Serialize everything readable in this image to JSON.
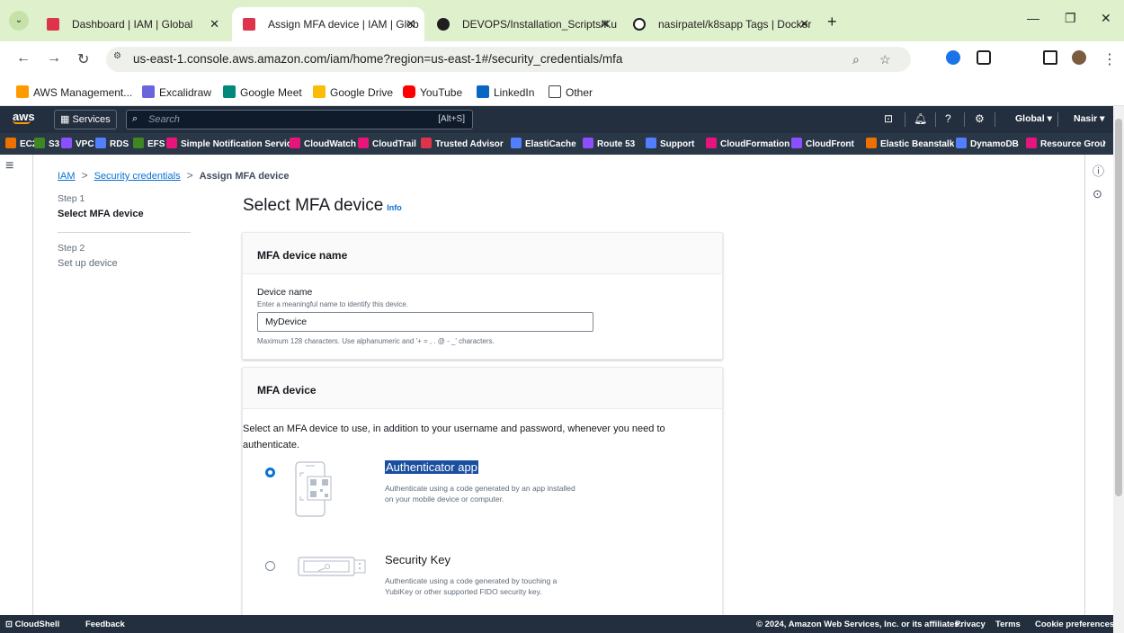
{
  "browser": {
    "tabs": [
      {
        "title": "Dashboard | IAM | Global",
        "icon": "aws-iam-favicon",
        "active": false
      },
      {
        "title": "Assign MFA device | IAM | Glob",
        "icon": "aws-iam-favicon",
        "active": true
      },
      {
        "title": "DEVOPS/Installation_Scripts/Ku",
        "icon": "github-icon",
        "active": false
      },
      {
        "title": "nasirpatel/k8sapp Tags | Docker",
        "icon": "docker-icon",
        "active": false
      }
    ],
    "new_tab": "+",
    "url": "us-east-1.console.aws.amazon.com/iam/home?region=us-east-1#/security_credentials/mfa",
    "bookmarks": [
      {
        "label": "AWS Management...",
        "color": "#ff9900"
      },
      {
        "label": "Excalidraw",
        "color": "#6965db"
      },
      {
        "label": "Google Meet",
        "color": "#00897b"
      },
      {
        "label": "Google Drive",
        "color": "#fbbc04"
      },
      {
        "label": "YouTube",
        "color": "#ff0000"
      },
      {
        "label": "LinkedIn",
        "color": "#0a66c2"
      },
      {
        "label": "Other",
        "color": "#ffffff"
      }
    ]
  },
  "aws_header": {
    "logo": "aws",
    "services": "Services",
    "search_placeholder": "Search",
    "search_shortcut": "[Alt+S]",
    "region": "Global ▾",
    "user": "Nasir ▾",
    "favorites": [
      {
        "label": "EC2",
        "color": "#ed7100"
      },
      {
        "label": "S3",
        "color": "#3f8624"
      },
      {
        "label": "VPC",
        "color": "#8c4fff"
      },
      {
        "label": "RDS",
        "color": "#527fff"
      },
      {
        "label": "EFS",
        "color": "#3f8624"
      },
      {
        "label": "Simple Notification Service",
        "color": "#e7157b"
      },
      {
        "label": "CloudWatch",
        "color": "#e7157b"
      },
      {
        "label": "CloudTrail",
        "color": "#e7157b"
      },
      {
        "label": "Trusted Advisor",
        "color": "#dd344c"
      },
      {
        "label": "ElastiCache",
        "color": "#527fff"
      },
      {
        "label": "Route 53",
        "color": "#8c4fff"
      },
      {
        "label": "Support",
        "color": "#527fff"
      },
      {
        "label": "CloudFormation",
        "color": "#e7157b"
      },
      {
        "label": "CloudFront",
        "color": "#8c4fff"
      },
      {
        "label": "Elastic Beanstalk",
        "color": "#ed7100"
      },
      {
        "label": "DynamoDB",
        "color": "#527fff"
      },
      {
        "label": "Resource Grou",
        "color": "#e7157b"
      }
    ]
  },
  "breadcrumb": {
    "iam": "IAM",
    "security_credentials": "Security credentials",
    "current": "Assign MFA device"
  },
  "steps": [
    {
      "label": "Step 1",
      "title": "Select MFA device"
    },
    {
      "label": "Step 2",
      "title": "Set up device"
    }
  ],
  "page": {
    "title": "Select MFA device",
    "info": "Info"
  },
  "name_panel": {
    "header": "MFA device name",
    "field_label": "Device name",
    "field_desc": "Enter a meaningful name to identify this device.",
    "value": "MyDevice",
    "constraint": "Maximum 128 characters. Use alphanumeric and '+ = , . @ - _' characters."
  },
  "device_panel": {
    "header": "MFA device",
    "description": "Select an MFA device to use, in addition to your username and password, whenever you need to authenticate.",
    "options": [
      {
        "title": "Authenticator app",
        "desc_1": "Authenticate using a code generated by an app installed",
        "desc_2": "on your mobile device or computer.",
        "selected": true
      },
      {
        "title": "Security Key",
        "desc_1": "Authenticate using a code generated by touching a",
        "desc_2": "YubiKey or other supported FIDO security key.",
        "selected": false
      }
    ]
  },
  "footer": {
    "cloudshell": "CloudShell",
    "feedback": "Feedback",
    "copyright": "© 2024, Amazon Web Services, Inc. or its affiliates.",
    "privacy": "Privacy",
    "terms": "Terms",
    "cookies": "Cookie preferences"
  }
}
